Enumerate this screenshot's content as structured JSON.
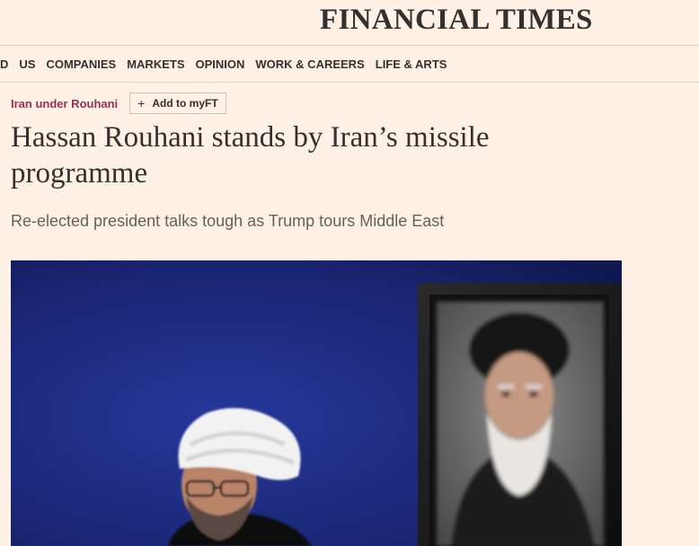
{
  "masthead": {
    "logo": "FINANCIAL TIMES"
  },
  "nav": {
    "items": [
      {
        "label": "D"
      },
      {
        "label": "US"
      },
      {
        "label": "COMPANIES"
      },
      {
        "label": "MARKETS"
      },
      {
        "label": "OPINION"
      },
      {
        "label": "WORK & CAREERS"
      },
      {
        "label": "LIFE & ARTS"
      }
    ]
  },
  "article": {
    "topic": "Iran under Rouhani",
    "myft_label": "Add to myFT",
    "headline": "Hassan Rouhani stands by Iran’s missile programme",
    "standfirst": "Re-elected president talks tough as Trump tours Middle East"
  },
  "colors": {
    "background": "#fff1e5",
    "topic": "#9e2f50",
    "hero_blue": "#1b2a7a"
  },
  "icons": {
    "myft": "plus-icon"
  }
}
